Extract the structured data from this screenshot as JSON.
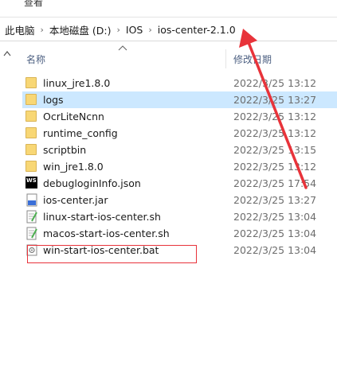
{
  "menu": {
    "view": "查看"
  },
  "breadcrumb": [
    {
      "label": "此电脑"
    },
    {
      "label": "本地磁盘 (D:)"
    },
    {
      "label": "IOS"
    },
    {
      "label": "ios-center-2.1.0"
    }
  ],
  "columns": {
    "name": "名称",
    "date": "修改日期"
  },
  "files": [
    {
      "name": "linux_jre1.8.0",
      "date": "2022/3/25 13:12",
      "icon": "folder-icon"
    },
    {
      "name": "logs",
      "date": "2022/3/25 13:27",
      "icon": "folder-icon",
      "selected": true
    },
    {
      "name": "OcrLiteNcnn",
      "date": "2022/3/25 13:12",
      "icon": "folder-icon"
    },
    {
      "name": "runtime_config",
      "date": "2022/3/25 13:12",
      "icon": "folder-icon"
    },
    {
      "name": "scriptbin",
      "date": "2022/3/25 13:15",
      "icon": "folder-icon"
    },
    {
      "name": "win_jre1.8.0",
      "date": "2022/3/25 13:12",
      "icon": "folder-icon"
    },
    {
      "name": "debugloginInfo.json",
      "date": "2022/3/25 17:54",
      "icon": "webstorm-icon"
    },
    {
      "name": "ios-center.jar",
      "date": "2022/3/25 13:27",
      "icon": "jar-file-icon"
    },
    {
      "name": "linux-start-ios-center.sh",
      "date": "2022/3/25 13:04",
      "icon": "script-file-icon"
    },
    {
      "name": "macos-start-ios-center.sh",
      "date": "2022/3/25 13:04",
      "icon": "script-file-icon"
    },
    {
      "name": "win-start-ios-center.bat",
      "date": "2022/3/25 13:04",
      "icon": "batch-file-icon"
    }
  ],
  "colors": {
    "selection": "#cce8ff",
    "annotation": "#e8333a",
    "folder": "#f8d775"
  }
}
